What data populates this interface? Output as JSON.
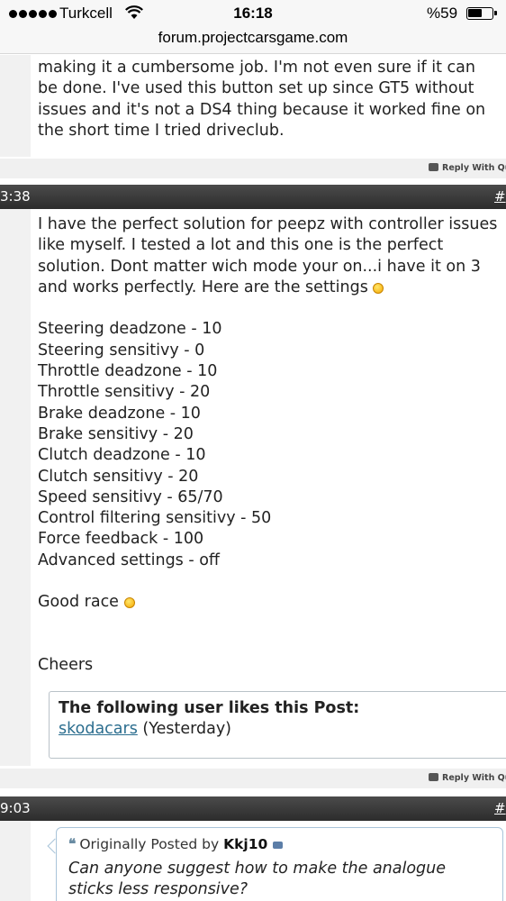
{
  "status_bar": {
    "carrier": "Turkcell",
    "time": "16:18",
    "battery_percent": "%59",
    "battery_level": 0.59
  },
  "browser": {
    "url": "forum.projectcarsgame.com"
  },
  "post1": {
    "lines": [
      "making it a cumbersome job. I'm not even sure if it can",
      "be done. I've used this button set up since GT5 without",
      "issues and it's not a DS4 thing because it worked fine on",
      "the short time I tried driveclub."
    ],
    "reply_label": "Reply With Quote"
  },
  "post2": {
    "header_time": "3:38",
    "header_num": "#",
    "intro_lines": [
      "I have the perfect solution for peepz with controller issues",
      "like myself. I tested a lot and this one is the perfect",
      "solution. Dont matter wich mode your on...i have it on 3",
      "and works perfectly. Here are the settings"
    ],
    "settings": [
      "Steering deadzone - 10",
      "Steering sensitivy - 0",
      "Throttle deadzone - 10",
      "Throttle sensitivy - 20",
      "Brake deadzone - 10",
      "Brake sensitivy - 20",
      "Clutch deadzone - 10",
      "Clutch sensitivy - 20",
      "Speed sensitivy - 65/70",
      "Control filtering sensitivy - 50",
      "Force feedback - 100",
      "Advanced settings - off"
    ],
    "good_race": "Good race",
    "cheers": "Cheers",
    "likes_title": "The following user likes this Post:",
    "likes_user": "skodacars",
    "likes_when": "(Yesterday)",
    "reply_label": "Reply With Quote"
  },
  "post3": {
    "header_time": "9:03",
    "header_num": "#",
    "quote_prefix": "Originally Posted by",
    "quote_author": "Kkj10",
    "quote_lines": [
      "Can anyone suggest how to make the analogue",
      "sticks less responsive?"
    ]
  },
  "colors": {
    "link": "#2c6e8f",
    "header_bar": "#3a3a3a",
    "quote_border": "#a9c4d9"
  }
}
